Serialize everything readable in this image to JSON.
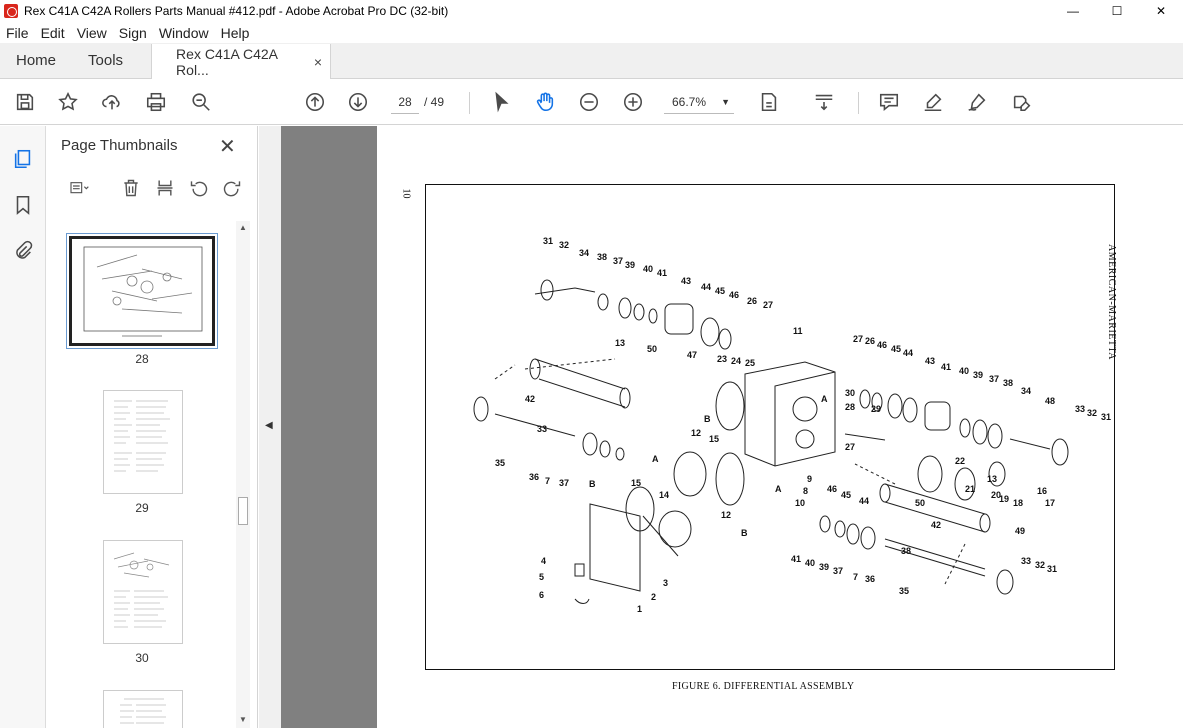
{
  "window": {
    "title": "Rex C41A C42A Rollers Parts Manual #412.pdf - Adobe Acrobat Pro DC (32-bit)",
    "minimize": "—",
    "maximize": "☐",
    "close": "✕"
  },
  "menu": [
    "File",
    "Edit",
    "View",
    "Sign",
    "Window",
    "Help"
  ],
  "tabs": {
    "home": "Home",
    "tools": "Tools",
    "document": "Rex C41A C42A Rol...",
    "close": "×"
  },
  "toolbar": {
    "page_current": "28",
    "page_total": "/ 49",
    "zoom": "66.7%"
  },
  "panel": {
    "title": "Page Thumbnails",
    "close": "✕",
    "thumbnails": [
      {
        "label": "28",
        "selected": true
      },
      {
        "label": "29",
        "selected": false
      },
      {
        "label": "30",
        "selected": false
      }
    ]
  },
  "document": {
    "page_number": "10",
    "side_text": "AMERICAN-MARIETTA",
    "caption": "FIGURE 6.  DIFFERENTIAL ASSEMBLY",
    "part_labels": [
      "31",
      "32",
      "34",
      "38",
      "37",
      "39",
      "40",
      "41",
      "43",
      "44",
      "45",
      "46",
      "26",
      "27",
      "11",
      "13",
      "50",
      "47",
      "23",
      "24",
      "25",
      "42",
      "33",
      "36",
      "7",
      "35",
      "12",
      "15",
      "14",
      "B",
      "A",
      "9",
      "8",
      "10",
      "3",
      "2",
      "1",
      "4",
      "5",
      "6",
      "16",
      "17",
      "18",
      "19",
      "20",
      "21",
      "22",
      "28",
      "29",
      "30",
      "48",
      "49"
    ]
  }
}
